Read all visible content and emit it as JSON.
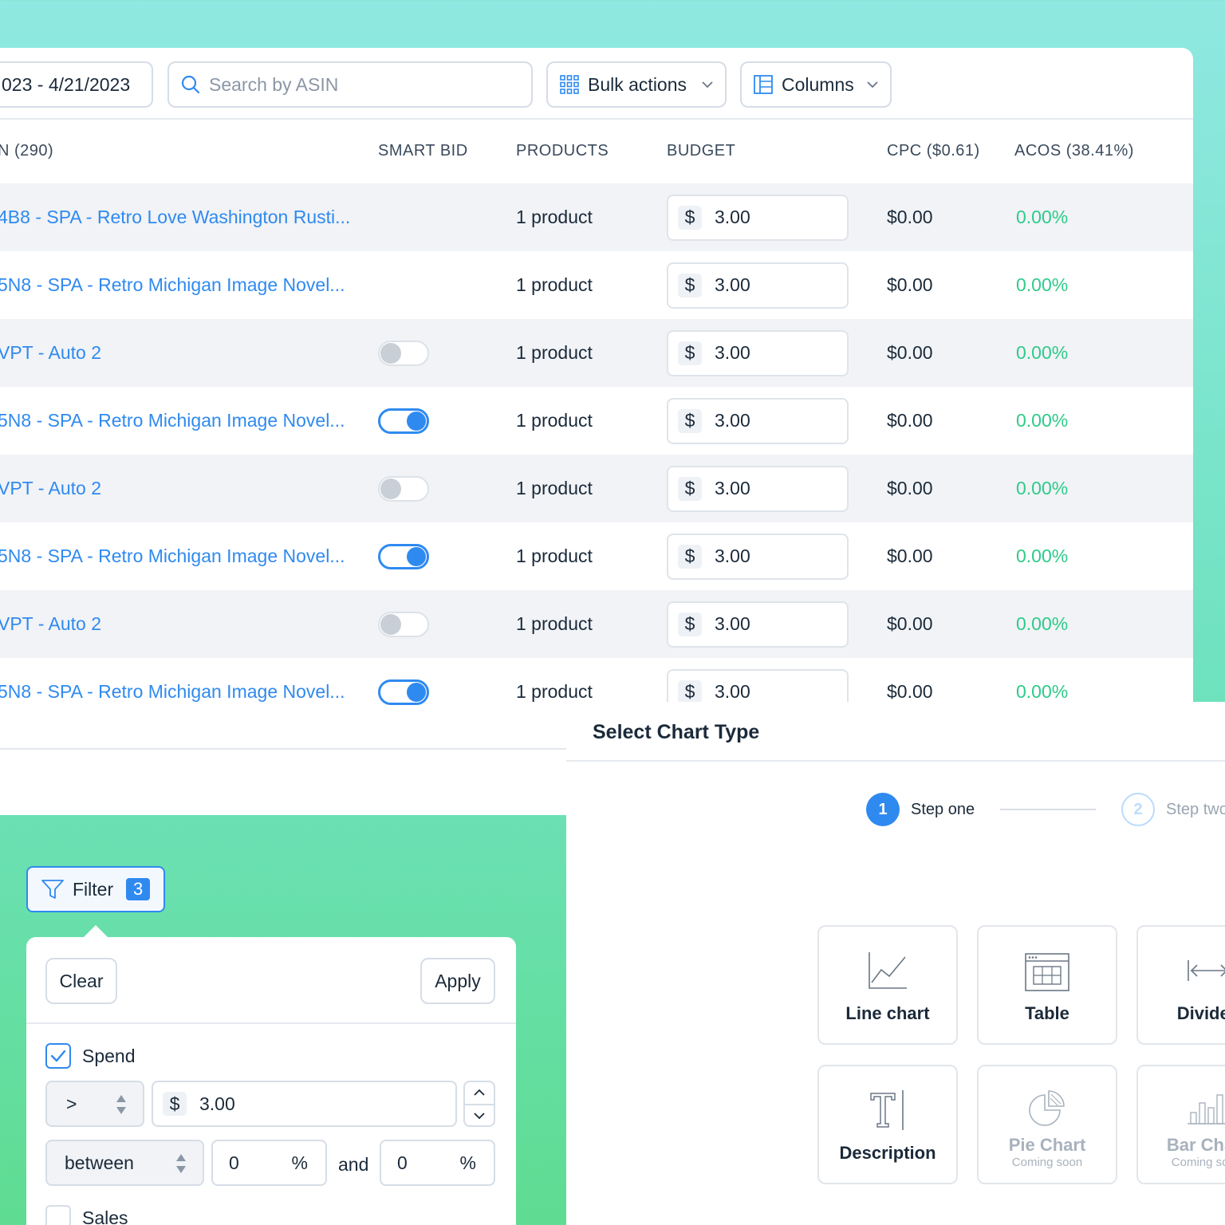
{
  "toolbar": {
    "date_range": "023 - 4/21/2023",
    "search_placeholder": "Search by ASIN",
    "bulk_actions_label": "Bulk actions",
    "columns_label": "Columns"
  },
  "table": {
    "headers": {
      "name": "N (290)",
      "smart_bid": "SMART BID",
      "products": "PRODUCTS",
      "budget": "BUDGET",
      "cpc": "CPC ($0.61)",
      "acos": "ACOS (38.41%)"
    },
    "rows": [
      {
        "name": "4B8 - SPA - Retro Love Washington Rusti...",
        "smart_bid": "none",
        "products": "1 product",
        "currency": "$",
        "budget": "3.00",
        "cpc": "$0.00",
        "acos": "0.00%"
      },
      {
        "name": "5N8 - SPA - Retro Michigan Image Novel...",
        "smart_bid": "none",
        "products": "1 product",
        "currency": "$",
        "budget": "3.00",
        "cpc": "$0.00",
        "acos": "0.00%"
      },
      {
        "name": "VPT - Auto 2",
        "smart_bid": "off",
        "products": "1 product",
        "currency": "$",
        "budget": "3.00",
        "cpc": "$0.00",
        "acos": "0.00%"
      },
      {
        "name": "5N8 - SPA - Retro Michigan Image Novel...",
        "smart_bid": "on",
        "products": "1 product",
        "currency": "$",
        "budget": "3.00",
        "cpc": "$0.00",
        "acos": "0.00%"
      },
      {
        "name": "VPT - Auto 2",
        "smart_bid": "off",
        "products": "1 product",
        "currency": "$",
        "budget": "3.00",
        "cpc": "$0.00",
        "acos": "0.00%"
      },
      {
        "name": "5N8 - SPA - Retro Michigan Image Novel...",
        "smart_bid": "on",
        "products": "1 product",
        "currency": "$",
        "budget": "3.00",
        "cpc": "$0.00",
        "acos": "0.00%"
      },
      {
        "name": "VPT - Auto 2",
        "smart_bid": "off",
        "products": "1 product",
        "currency": "$",
        "budget": "3.00",
        "cpc": "$0.00",
        "acos": "0.00%"
      },
      {
        "name": "5N8 - SPA - Retro Michigan Image Novel...",
        "smart_bid": "on",
        "products": "1 product",
        "currency": "$",
        "budget": "3.00",
        "cpc": "$0.00",
        "acos": "0.00%"
      }
    ]
  },
  "filter": {
    "button_label": "Filter",
    "count": "3",
    "clear_label": "Clear",
    "apply_label": "Apply",
    "spend": {
      "checked": true,
      "label": "Spend",
      "operator": ">",
      "currency": "$",
      "value": "3.00",
      "range_operator": "between",
      "range_from": "0",
      "range_to": "0",
      "unit": "%",
      "and_label": "and"
    },
    "sales": {
      "checked": false,
      "label": "Sales"
    }
  },
  "chart_type": {
    "title": "Select Chart Type",
    "steps": [
      {
        "number": "1",
        "label": "Step one",
        "active": true
      },
      {
        "number": "2",
        "label": "Step two",
        "active": false
      }
    ],
    "options": [
      {
        "name": "Line chart",
        "icon": "line-chart-icon",
        "sub": ""
      },
      {
        "name": "Table",
        "icon": "table-icon",
        "sub": ""
      },
      {
        "name": "Divider",
        "icon": "divider-icon",
        "sub": ""
      },
      {
        "name": "Description",
        "icon": "text-icon",
        "sub": ""
      },
      {
        "name": "Pie Chart",
        "icon": "pie-chart-icon",
        "sub": "Coming soon"
      },
      {
        "name": "Bar Chart",
        "icon": "bar-chart-icon",
        "sub": "Coming soon"
      }
    ]
  },
  "colors": {
    "accent": "#2f8af0",
    "positive": "#2ecb8a",
    "background_top": "#8fe8e1",
    "background_bottom": "#5fdc92"
  }
}
